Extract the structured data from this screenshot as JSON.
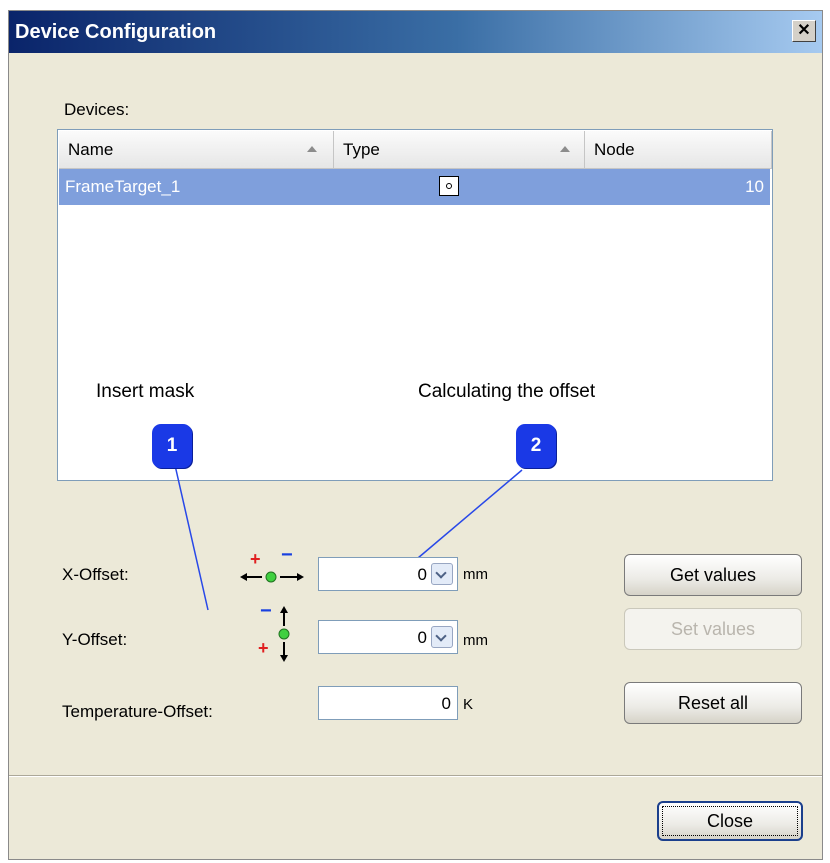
{
  "window": {
    "title": "Device Configuration",
    "close_glyph": "✕"
  },
  "devices": {
    "label": "Devices:",
    "columns": [
      "Name",
      "Type",
      "Node"
    ],
    "rows": [
      {
        "name": "FrameTarget_1",
        "type_icon": "frame-target-icon",
        "node": "10"
      }
    ]
  },
  "annotations": [
    {
      "number": "1",
      "text": "Insert mask"
    },
    {
      "number": "2",
      "text": "Calculating the offset"
    }
  ],
  "offsets": {
    "x": {
      "label": "X-Offset:",
      "value": "0",
      "unit": "mm",
      "icon": "x-offset-arrows-icon",
      "plus": "+",
      "minus": "−"
    },
    "y": {
      "label": "Y-Offset:",
      "value": "0",
      "unit": "mm",
      "icon": "y-offset-arrows-icon",
      "plus": "+",
      "minus": "−"
    },
    "temperature": {
      "label": "Temperature-Offset:",
      "value": "0",
      "unit": "K"
    }
  },
  "buttons": {
    "get_values": "Get values",
    "set_values": "Set values",
    "reset_all": "Reset all",
    "close": "Close"
  },
  "colors": {
    "selection": "#7f9fdc",
    "badge": "#1a39e6",
    "plus": "#e02020",
    "minus": "#1840e0"
  }
}
